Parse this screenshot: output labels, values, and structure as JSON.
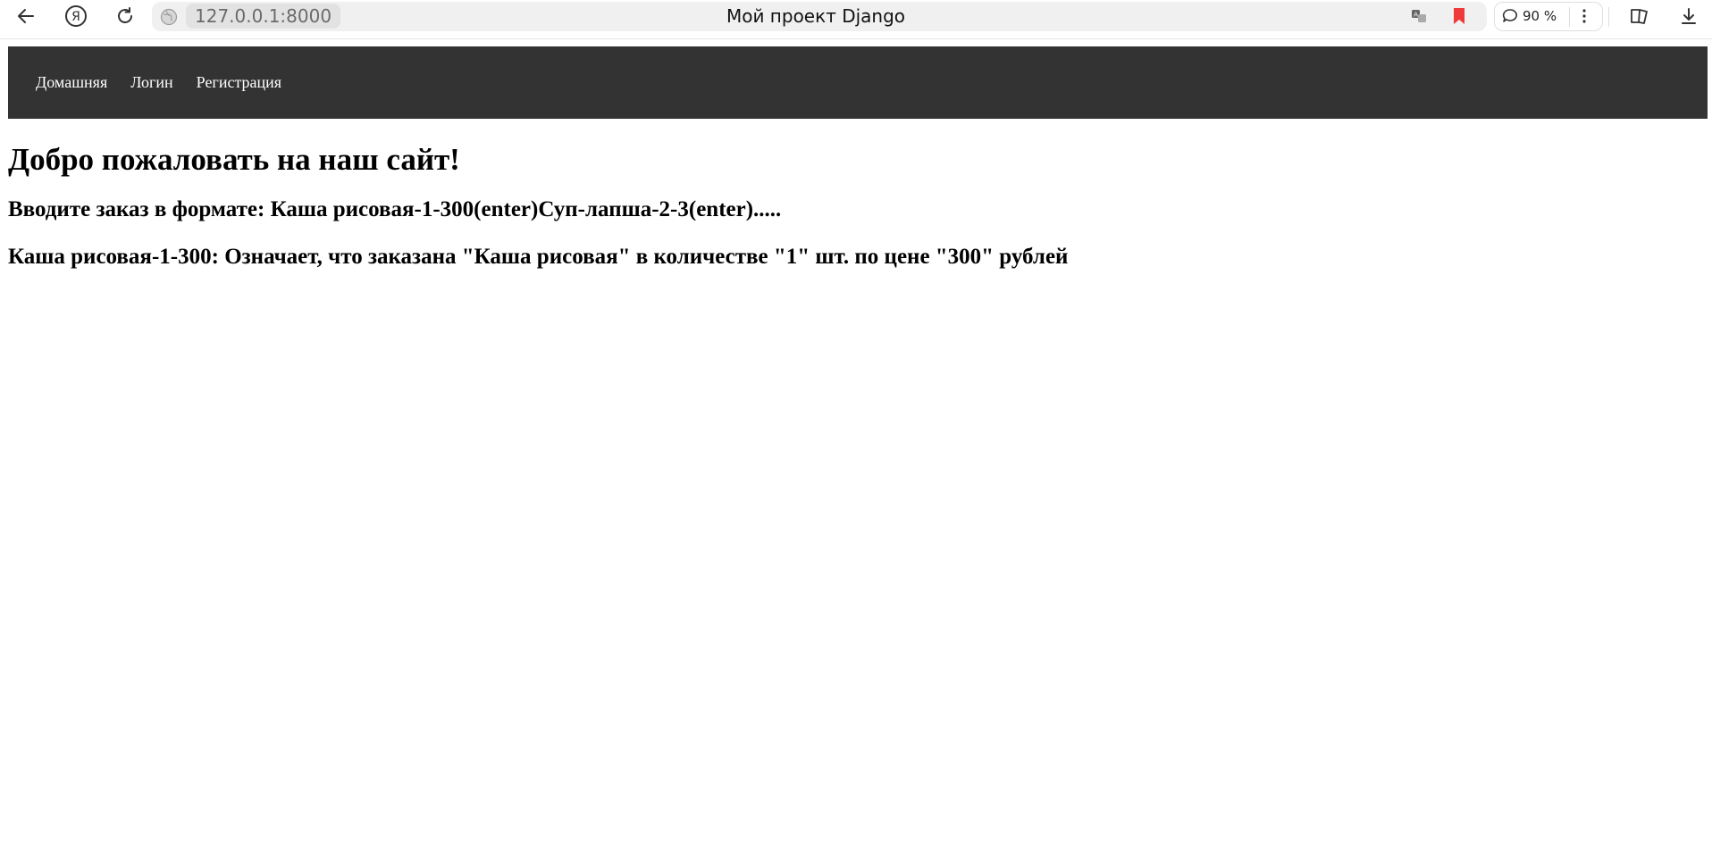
{
  "browser": {
    "url": "127.0.0.1:8000",
    "tab_title": "Мой проект Django",
    "zoom": "90 %",
    "icons": {
      "back": "back-arrow-icon",
      "yandex": "yandex-logo-icon",
      "reload": "reload-icon",
      "site": "site-info-icon",
      "translate": "translate-icon",
      "bookmark": "bookmark-icon",
      "zoom": "zoom-chat-icon",
      "menu": "vertical-dots-icon",
      "collections": "collections-icon",
      "download": "download-icon"
    },
    "colors": {
      "bookmark": "#ee3a3a"
    }
  },
  "nav": {
    "background": "#333333",
    "items": [
      {
        "label": "Домашняя"
      },
      {
        "label": "Логин"
      },
      {
        "label": "Регистрация"
      }
    ]
  },
  "main": {
    "title": "Добро пожаловать на наш сайт!",
    "instruction": "Вводите заказ в формате: Каша рисовая-1-300(enter)Суп-лапша-2-3(enter).....",
    "example": "Каша рисовая-1-300: Означает, что заказана \"Каша рисовая\" в количестве \"1\" шт. по цене \"300\" рублей"
  }
}
